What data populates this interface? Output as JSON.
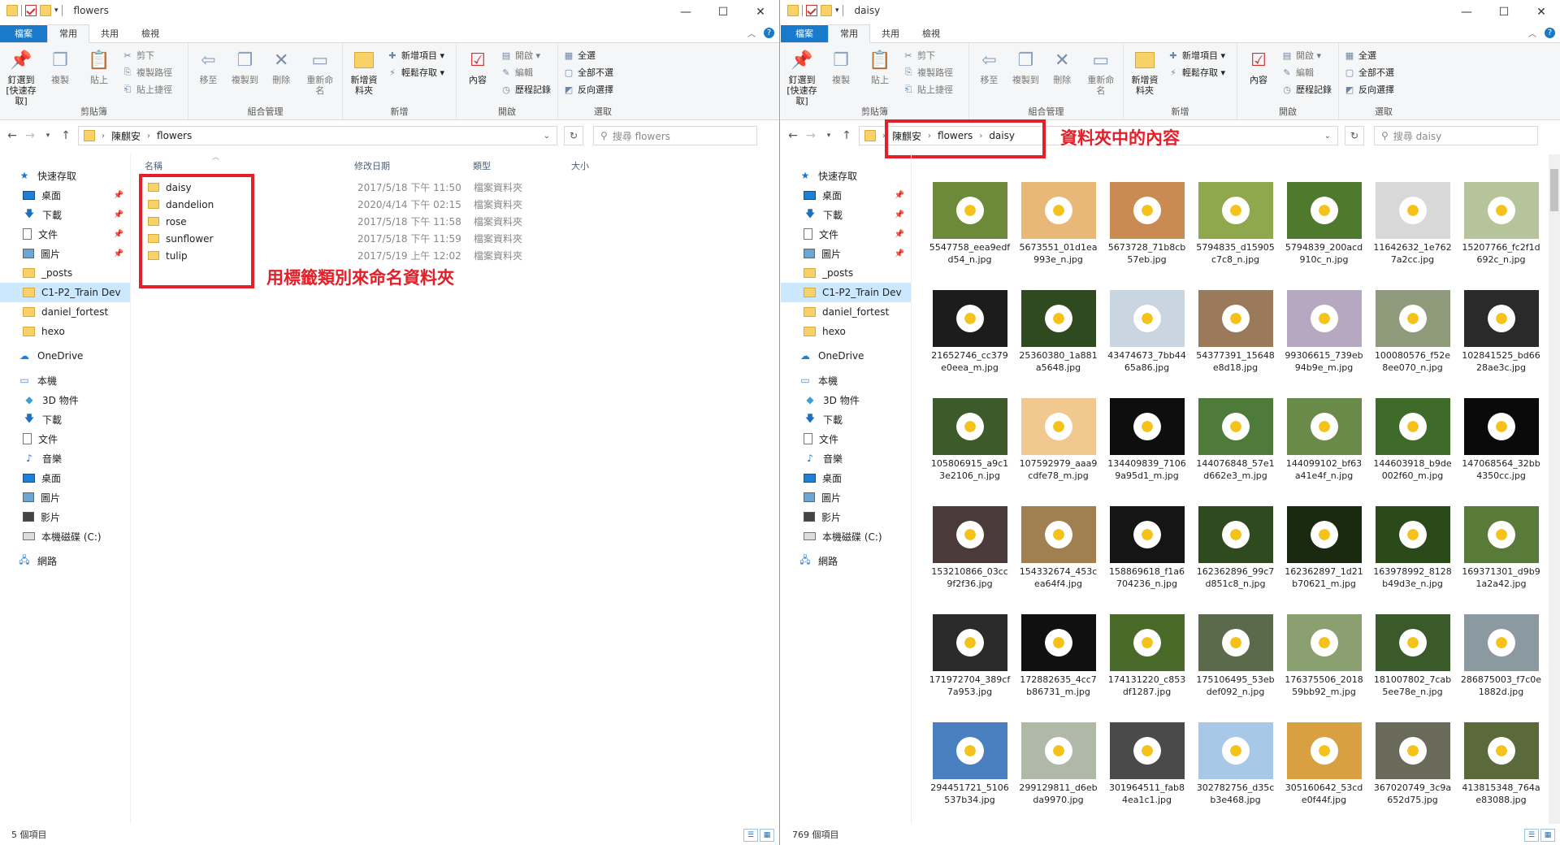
{
  "common": {
    "window_buttons": {
      "min": "—",
      "max": "☐",
      "close": "✕"
    },
    "tabs": [
      "檔案",
      "常用",
      "共用",
      "檢視"
    ],
    "ribbon": {
      "clipboard": {
        "pin": "釘選到 [快速存取]",
        "copy": "複製",
        "paste": "貼上",
        "cut": "剪下",
        "copy_path": "複製路徑",
        "paste_shortcut": "貼上捷徑",
        "label": "剪貼簿"
      },
      "organize": {
        "move": "移至",
        "copyto": "複製到",
        "delete": "刪除",
        "rename": "重新命名",
        "label": "組合管理"
      },
      "new": {
        "new_folder": "新增資料夾",
        "new_item": "新增項目 ▾",
        "easy_access": "輕鬆存取 ▾",
        "label": "新增"
      },
      "open": {
        "properties": "內容",
        "open": "開啟 ▾",
        "edit": "編輯",
        "history": "歷程記錄",
        "label": "開啟"
      },
      "select": {
        "all": "全選",
        "none": "全部不選",
        "invert": "反向選擇",
        "label": "選取"
      }
    },
    "nav": {
      "quick_access": "快速存取",
      "qa_items": [
        "桌面",
        "下載",
        "文件",
        "圖片",
        "_posts",
        "C1-P2_Train Dev",
        "daniel_fortest",
        "hexo"
      ],
      "onedrive": "OneDrive",
      "this_pc": "本機",
      "pc_items": [
        "3D 物件",
        "下載",
        "文件",
        "音樂",
        "桌面",
        "圖片",
        "影片",
        "本機磁碟 (C:)"
      ],
      "network": "網路"
    }
  },
  "left": {
    "title": "flowers",
    "breadcrumb": [
      "陳麒安",
      "flowers"
    ],
    "search_placeholder": "搜尋 flowers",
    "columns": {
      "name": "名稱",
      "date": "修改日期",
      "type": "類型",
      "size": "大小"
    },
    "files": [
      {
        "name": "daisy",
        "date": "2017/5/18 下午 11:50",
        "type": "檔案資料夾"
      },
      {
        "name": "dandelion",
        "date": "2020/4/14 下午 02:15",
        "type": "檔案資料夾"
      },
      {
        "name": "rose",
        "date": "2017/5/18 下午 11:58",
        "type": "檔案資料夾"
      },
      {
        "name": "sunflower",
        "date": "2017/5/18 下午 11:59",
        "type": "檔案資料夾"
      },
      {
        "name": "tulip",
        "date": "2017/5/19 上午 12:02",
        "type": "檔案資料夾"
      }
    ],
    "annotation": "用標籤類別來命名資料夾",
    "status": "5 個項目"
  },
  "right": {
    "title": "daisy",
    "breadcrumb": [
      "陳麒安",
      "flowers",
      "daisy"
    ],
    "search_placeholder": "搜尋 daisy",
    "annotation": "資料夾中的內容",
    "status": "769 個項目",
    "thumbnails": [
      "5547758_eea9edfd54_n.jpg",
      "5673551_01d1ea993e_n.jpg",
      "5673728_71b8cb57eb.jpg",
      "5794835_d15905c7c8_n.jpg",
      "5794839_200acd910c_n.jpg",
      "11642632_1e7627a2cc.jpg",
      "15207766_fc2f1d692c_n.jpg",
      "21652746_cc379e0eea_m.jpg",
      "25360380_1a881a5648.jpg",
      "43474673_7bb4465a86.jpg",
      "54377391_15648e8d18.jpg",
      "99306615_739eb94b9e_m.jpg",
      "100080576_f52e8ee070_n.jpg",
      "102841525_bd6628ae3c.jpg",
      "105806915_a9c13e2106_n.jpg",
      "107592979_aaa9cdfe78_m.jpg",
      "134409839_71069a95d1_m.jpg",
      "144076848_57e1d662e3_m.jpg",
      "144099102_bf63a41e4f_n.jpg",
      "144603918_b9de002f60_m.jpg",
      "147068564_32bb4350cc.jpg",
      "153210866_03cc9f2f36.jpg",
      "154332674_453cea64f4.jpg",
      "158869618_f1a6704236_n.jpg",
      "162362896_99c7d851c8_n.jpg",
      "162362897_1d21b70621_m.jpg",
      "163978992_8128b49d3e_n.jpg",
      "169371301_d9b91a2a42.jpg",
      "171972704_389cf7a953.jpg",
      "172882635_4cc7b86731_m.jpg",
      "174131220_c853df1287.jpg",
      "175106495_53ebdef092_n.jpg",
      "176375506_201859bb92_m.jpg",
      "181007802_7cab5ee78e_n.jpg",
      "286875003_f7c0e1882d.jpg",
      "294451721_5106537b34.jpg",
      "299129811_d6ebda9970.jpg",
      "301964511_fab84ea1c1.jpg",
      "302782756_d35cb3e468.jpg",
      "305160642_53cde0f44f.jpg",
      "367020749_3c9a652d75.jpg",
      "413815348_764ae83088.jpg"
    ]
  }
}
